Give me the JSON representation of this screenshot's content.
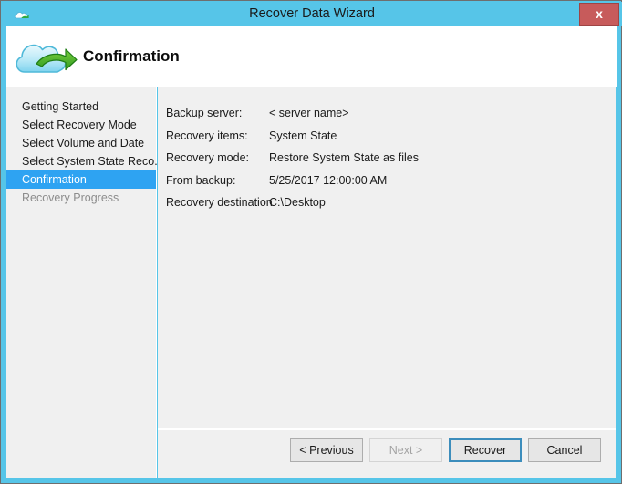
{
  "window": {
    "title": "Recover Data Wizard",
    "title_icon": "cloud-icon",
    "close_label": "x",
    "accent_color": "#56c5e8",
    "close_color": "#c75b5b"
  },
  "header": {
    "icon": "cloud-recovery-icon",
    "heading": "Confirmation"
  },
  "sidebar": {
    "items": [
      {
        "label": "Getting Started",
        "state": "normal"
      },
      {
        "label": "Select Recovery Mode",
        "state": "normal"
      },
      {
        "label": "Select Volume and Date",
        "state": "normal"
      },
      {
        "label": "Select System State Reco...",
        "state": "normal"
      },
      {
        "label": "Confirmation",
        "state": "selected"
      },
      {
        "label": "Recovery Progress",
        "state": "disabled"
      }
    ],
    "selected_color": "#2ea3f2"
  },
  "main": {
    "details": [
      {
        "label": "Backup server:",
        "value": "< server name>"
      },
      {
        "label": "Recovery items:",
        "value": "System State"
      },
      {
        "label": "Recovery mode:",
        "value": "Restore System State as files"
      },
      {
        "label": "From backup:",
        "value": "5/25/2017 12:00:00 AM"
      },
      {
        "label": "Recovery destination",
        "value": "C:\\Desktop"
      }
    ]
  },
  "footer": {
    "buttons": [
      {
        "label": "< Previous",
        "state": "enabled"
      },
      {
        "label": "Next >",
        "state": "disabled"
      },
      {
        "label": "Recover",
        "state": "focused"
      },
      {
        "label": "Cancel",
        "state": "enabled"
      }
    ]
  }
}
